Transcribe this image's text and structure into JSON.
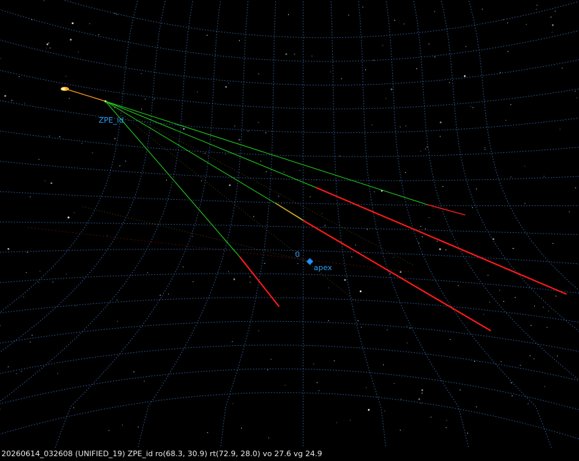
{
  "labels": {
    "source": "ZPE_id",
    "origin": "0",
    "apex": "apex"
  },
  "status": {
    "text": "20260614_032608 (UNIFIED_19) ZPE_id ro(68.3, 30.9) rt(72.9, 28.0) vo 27.6 vg 24.9"
  },
  "colors": {
    "background": "#000000",
    "grid": "#2f5f9f",
    "label": "#2a9df4",
    "ray_near": "#22d21e",
    "ray_far": "#ff1a1a",
    "ray_mid": "#d8b020",
    "source_glow": "#ffb020",
    "apex_marker": "#1e90ff",
    "status_text": "#e8e8e8"
  }
}
